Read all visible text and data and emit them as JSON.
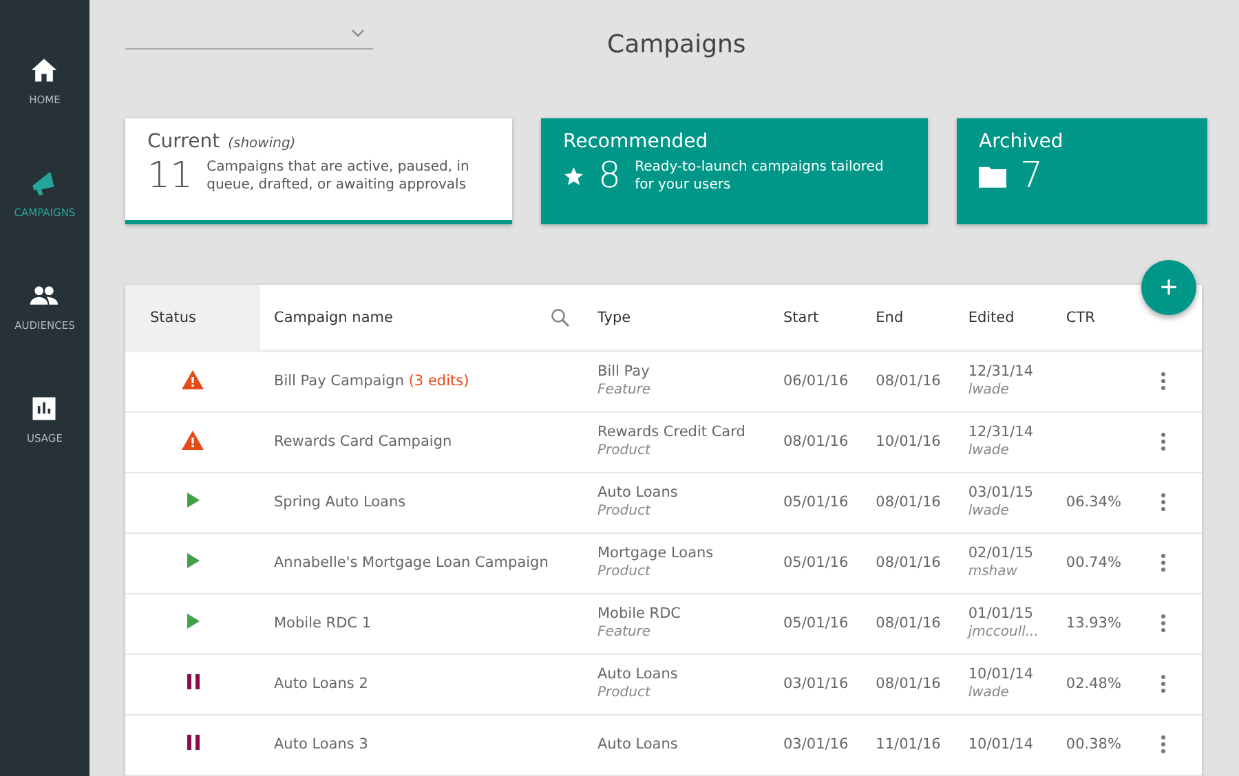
{
  "sidebar": {
    "items": [
      {
        "label": "HOME",
        "selected": false
      },
      {
        "label": "CAMPAIGNS",
        "selected": true
      },
      {
        "label": "AUDIENCES",
        "selected": false
      },
      {
        "label": "USAGE",
        "selected": false
      }
    ]
  },
  "page_title": "Campaigns",
  "cards": [
    {
      "title": "Current",
      "note": "(showing)",
      "count": "11",
      "description": "Campaigns that are active, paused, in queue, drafted, or awaiting approvals",
      "selected": true
    },
    {
      "title": "Recommended",
      "count": "8",
      "description": "Ready-to-launch campaigns tailored for your users",
      "selected": false
    },
    {
      "title": "Archived",
      "count": "7",
      "selected": false
    }
  ],
  "add_button": "+",
  "table": {
    "columns": [
      "Status",
      "Campaign name",
      "Type",
      "Start",
      "End",
      "Edited",
      "CTR"
    ],
    "rows": [
      {
        "kind": "warning",
        "name": "Bill Pay Campaign",
        "edits": "(3 edits)",
        "type": "Bill Pay",
        "subtype": "Feature",
        "start": "06/01/16",
        "end": "08/01/16",
        "edited": "12/31/14",
        "editor": "lwade"
      },
      {
        "kind": "warning",
        "name": "Rewards Card Campaign",
        "type": "Rewards Credit Card",
        "subtype": "Product",
        "start": "08/01/16",
        "end": "10/01/16",
        "edited": "12/31/14",
        "editor": "lwade"
      },
      {
        "kind": "active",
        "name": "Spring Auto Loans",
        "type": "Auto Loans",
        "subtype": "Product",
        "start": "05/01/16",
        "end": "08/01/16",
        "edited": "03/01/15",
        "editor": "lwade",
        "ctr": "06.34%"
      },
      {
        "kind": "active",
        "name": "Annabelle's Mortgage Loan Campaign",
        "type": "Mortgage Loans",
        "subtype": "Product",
        "start": "05/01/16",
        "end": "08/01/16",
        "edited": "02/01/15",
        "editor": "mshaw",
        "ctr": "00.74%"
      },
      {
        "kind": "active",
        "name": "Mobile RDC 1",
        "type": "Mobile RDC",
        "subtype": "Feature",
        "start": "05/01/16",
        "end": "08/01/16",
        "edited": "01/01/15",
        "editor": "jmccoull...",
        "ctr": "13.93%"
      },
      {
        "kind": "paused",
        "name": "Auto Loans 2",
        "type": "Auto Loans",
        "subtype": "Product",
        "start": "03/01/16",
        "end": "08/01/16",
        "edited": "10/01/14",
        "editor": "lwade",
        "ctr": "02.48%"
      },
      {
        "kind": "paused",
        "name": "Auto Loans 3",
        "type": "Auto Loans",
        "start": "03/01/16",
        "end": "11/01/16",
        "edited": "10/01/14",
        "ctr": "00.38%"
      }
    ]
  }
}
